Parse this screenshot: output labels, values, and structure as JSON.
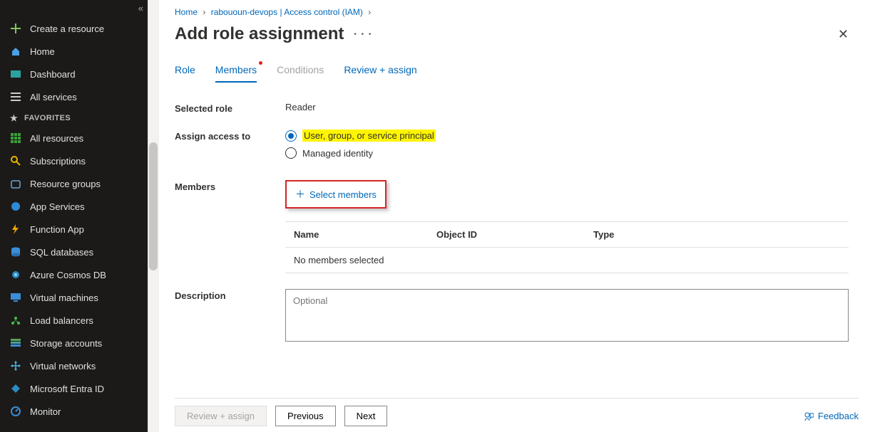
{
  "sidebar": {
    "create": "Create a resource",
    "home": "Home",
    "dashboard": "Dashboard",
    "all_services": "All services",
    "favorites_header": "FAVORITES",
    "items": [
      "All resources",
      "Subscriptions",
      "Resource groups",
      "App Services",
      "Function App",
      "SQL databases",
      "Azure Cosmos DB",
      "Virtual machines",
      "Load balancers",
      "Storage accounts",
      "Virtual networks",
      "Microsoft Entra ID",
      "Monitor"
    ]
  },
  "breadcrumb": {
    "home": "Home",
    "iam": "rabououn-devops | Access control (IAM)"
  },
  "page_title": "Add role assignment",
  "tabs": {
    "role": "Role",
    "members": "Members",
    "conditions": "Conditions",
    "review": "Review + assign"
  },
  "form": {
    "selected_role_label": "Selected role",
    "selected_role_value": "Reader",
    "assign_label": "Assign access to",
    "opt_user": "User, group, or service principal",
    "opt_mi": "Managed identity",
    "members_label": "Members",
    "select_members": "Select members",
    "table": {
      "name": "Name",
      "objid": "Object ID",
      "type": "Type",
      "empty": "No members selected"
    },
    "description_label": "Description",
    "description_placeholder": "Optional"
  },
  "footer": {
    "review": "Review + assign",
    "previous": "Previous",
    "next": "Next",
    "feedback": "Feedback"
  }
}
